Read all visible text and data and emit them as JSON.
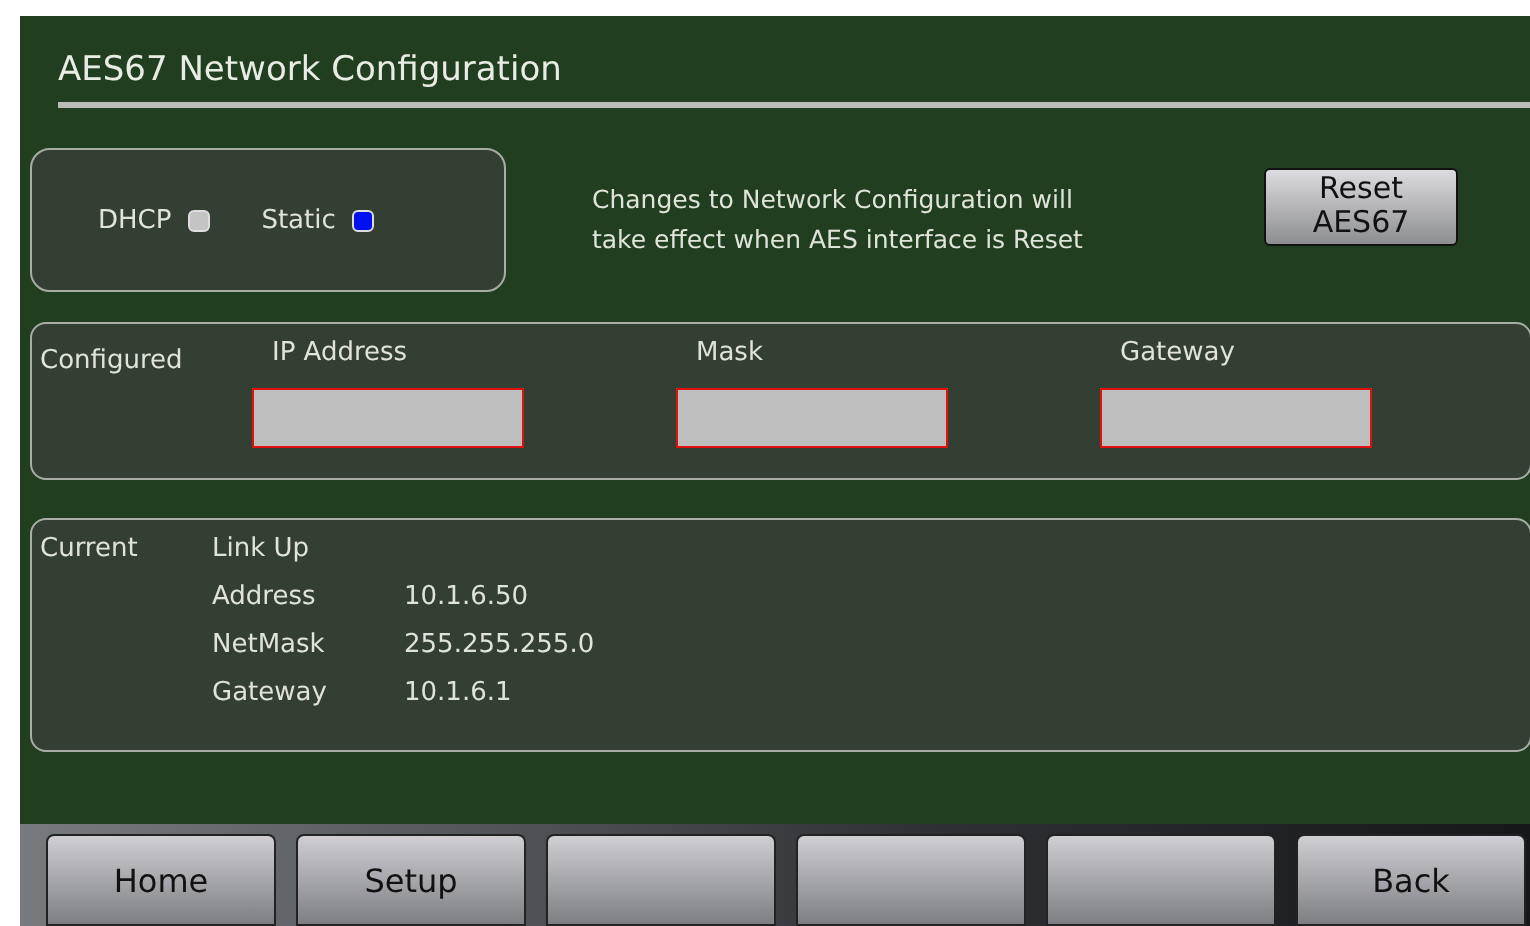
{
  "title": "AES67 Network Configuration",
  "modes": [
    {
      "label": "DHCP",
      "selected": false
    },
    {
      "label": "Static",
      "selected": true
    }
  ],
  "notice": "Changes to Network Configuration will take effect when AES interface is Reset",
  "reset_button": "Reset AES67",
  "configured": {
    "label": "Configured",
    "fields": [
      {
        "label": "IP Address"
      },
      {
        "label": "Mask"
      },
      {
        "label": "Gateway"
      }
    ]
  },
  "current": {
    "label": "Current",
    "status": "Link Up",
    "rows": [
      {
        "name": "Address",
        "value": "10.1.6.50"
      },
      {
        "name": "NetMask",
        "value": "255.255.255.0"
      },
      {
        "name": "Gateway",
        "value": "10.1.6.1"
      }
    ]
  },
  "nav_buttons": [
    {
      "kind": "labeled",
      "label": "Home"
    },
    {
      "kind": "labeled",
      "label": "Setup"
    },
    {
      "kind": "blank"
    },
    {
      "kind": "blank"
    },
    {
      "kind": "blank"
    },
    {
      "kind": "labeled",
      "label": "Back"
    }
  ]
}
